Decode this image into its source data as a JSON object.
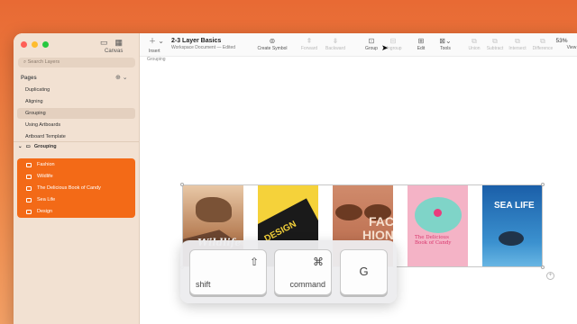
{
  "window": {
    "traffic_colors": [
      "#ff5f57",
      "#febc2e",
      "#28c840"
    ]
  },
  "sidebar": {
    "canvas_label": "Canvas",
    "search_placeholder": "Search Layers",
    "pages_heading": "Pages",
    "pages": [
      {
        "label": "Duplicating",
        "active": false
      },
      {
        "label": "Aligning",
        "active": false
      },
      {
        "label": "Grouping",
        "active": true
      },
      {
        "label": "Using Artboards",
        "active": false
      },
      {
        "label": "Artboard Template",
        "active": false
      }
    ],
    "layer_group": "Grouping",
    "layers": [
      "Fashion",
      "Wildlife",
      "The Delicious Book of Candy",
      "Sea Life",
      "Design"
    ]
  },
  "toolbar": {
    "insert": "Insert",
    "doc_title": "2-3 Layer Basics",
    "doc_subtitle": "Workspace Document — Edited",
    "create_symbol": "Create Symbol",
    "forward": "Forward",
    "backward": "Backward",
    "group": "Group",
    "ungroup": "Ungroup",
    "edit": "Edit",
    "tools": "Tools",
    "union": "Union",
    "subtract": "Subtract",
    "intersect": "Intersect",
    "difference": "Difference",
    "zoom": "53%",
    "view": "View"
  },
  "canvas": {
    "page_label": "Grouping",
    "artboards": [
      {
        "name": "Wildlife",
        "bg": "#c9a07a",
        "text": "Wildlife"
      },
      {
        "name": "Design",
        "bg": "#f5d23a",
        "text": "DESIGN"
      },
      {
        "name": "Fashion",
        "bg": "#c8775a",
        "text": "FAC HION"
      },
      {
        "name": "Candy",
        "bg": "#f4b3c6",
        "text": "The Delicious Book of Candy"
      },
      {
        "name": "Sea Life",
        "bg": "#2d7fc2",
        "text": "SEA LIFE"
      }
    ]
  },
  "shortcut": {
    "shift_label": "shift",
    "shift_symbol": "⇧",
    "command_label": "command",
    "command_symbol": "⌘",
    "g_label": "G"
  }
}
